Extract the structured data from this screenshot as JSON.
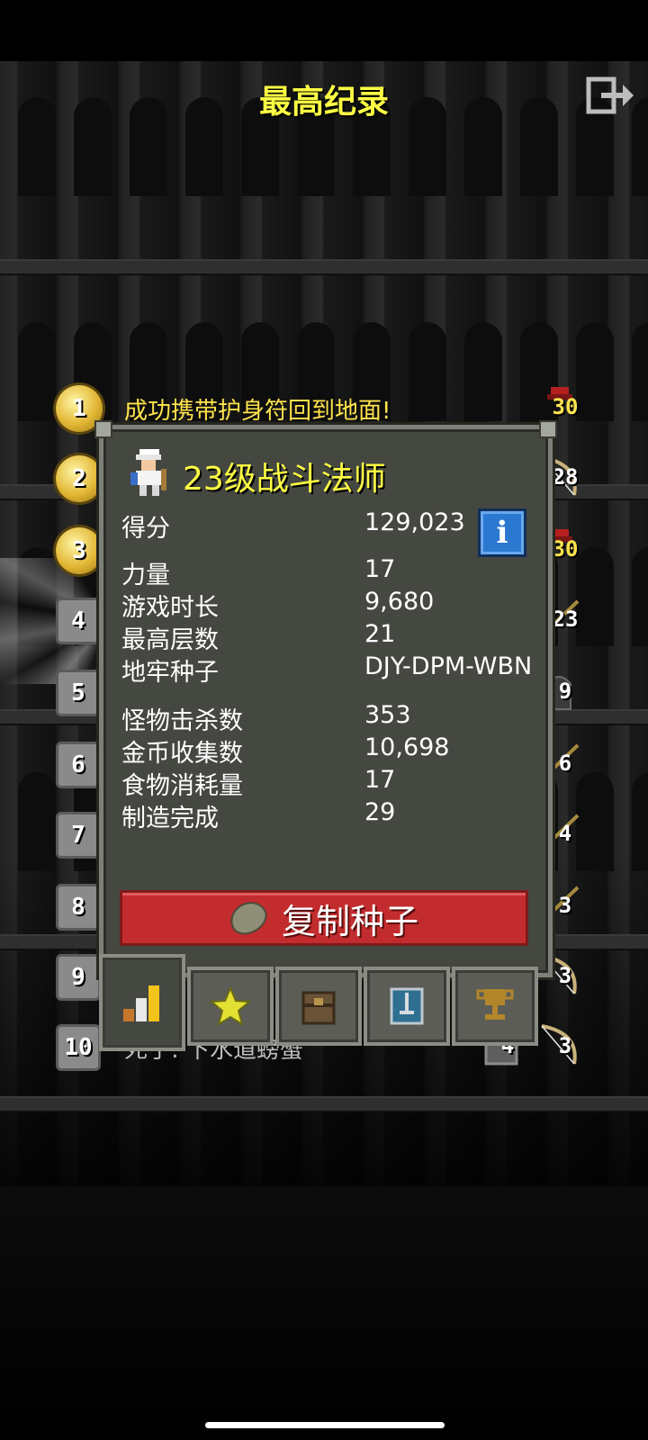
{
  "header": {
    "title": "最高纪录",
    "exit_icon": "exit-door-icon"
  },
  "rankings": [
    {
      "rank": "1",
      "badge": "gold",
      "text": "成功携带护身符回到地面!",
      "text_color": "gold",
      "depth": "30",
      "class_icon": "helmet-red-icon"
    },
    {
      "rank": "2",
      "badge": "gold",
      "text": "",
      "depth": "28",
      "class_icon": "bow-icon"
    },
    {
      "rank": "3",
      "badge": "gold",
      "text": "",
      "depth": "30",
      "class_icon": "helmet-red-icon"
    },
    {
      "rank": "4",
      "badge": "grey",
      "text": "",
      "depth": "23",
      "class_icon": "staff-icon"
    },
    {
      "rank": "5",
      "badge": "grey",
      "text": "",
      "depth": "9",
      "class_icon": "hood-icon"
    },
    {
      "rank": "6",
      "badge": "grey",
      "text": "",
      "depth": "6",
      "class_icon": "staff-icon"
    },
    {
      "rank": "7",
      "badge": "grey",
      "text": "",
      "depth": "4",
      "class_icon": "staff-icon"
    },
    {
      "rank": "8",
      "badge": "grey",
      "text": "",
      "depth": "3",
      "class_icon": "staff-icon"
    },
    {
      "rank": "9",
      "badge": "grey",
      "text": "",
      "depth": "3",
      "class_icon": "bow-icon"
    },
    {
      "rank": "10",
      "badge": "grey",
      "text": "死于: 下水道螃蟹",
      "text_color": "grey",
      "depth": "4",
      "depth_icon": "tower-icon",
      "extra_depth": "3",
      "class_icon": "bow-icon"
    }
  ],
  "detail": {
    "hero_icon": "battlemage-icon",
    "title": "23级战斗法师",
    "info_icon": "info-icon",
    "stats": [
      {
        "label": "得分",
        "value": "129,023"
      },
      {
        "label": "力量",
        "value": "17"
      },
      {
        "label": "游戏时长",
        "value": "9,680"
      },
      {
        "label": "最高层数",
        "value": "21"
      },
      {
        "label": "地牢种子",
        "value": "DJY-DPM-WBN"
      },
      {
        "label": "怪物击杀数",
        "value": "353"
      },
      {
        "label": "金币收集数",
        "value": "10,698"
      },
      {
        "label": "食物消耗量",
        "value": "17"
      },
      {
        "label": "制造完成",
        "value": "29"
      }
    ],
    "copy_button": {
      "label": "复制种子",
      "icon": "seed-icon"
    },
    "tabs": [
      {
        "name": "stats",
        "icon": "bar-chart-icon",
        "active": true
      },
      {
        "name": "badges",
        "icon": "star-icon",
        "active": false
      },
      {
        "name": "items",
        "icon": "backpack-icon",
        "active": false
      },
      {
        "name": "challenges",
        "icon": "sword-shield-icon",
        "active": false
      },
      {
        "name": "achievements",
        "icon": "trophy-icon",
        "active": false
      }
    ]
  },
  "colors": {
    "title": "#ffff44",
    "panel_bg": "#454741",
    "copy_button": "#c32c2e",
    "info_button": "#2b78d0"
  }
}
